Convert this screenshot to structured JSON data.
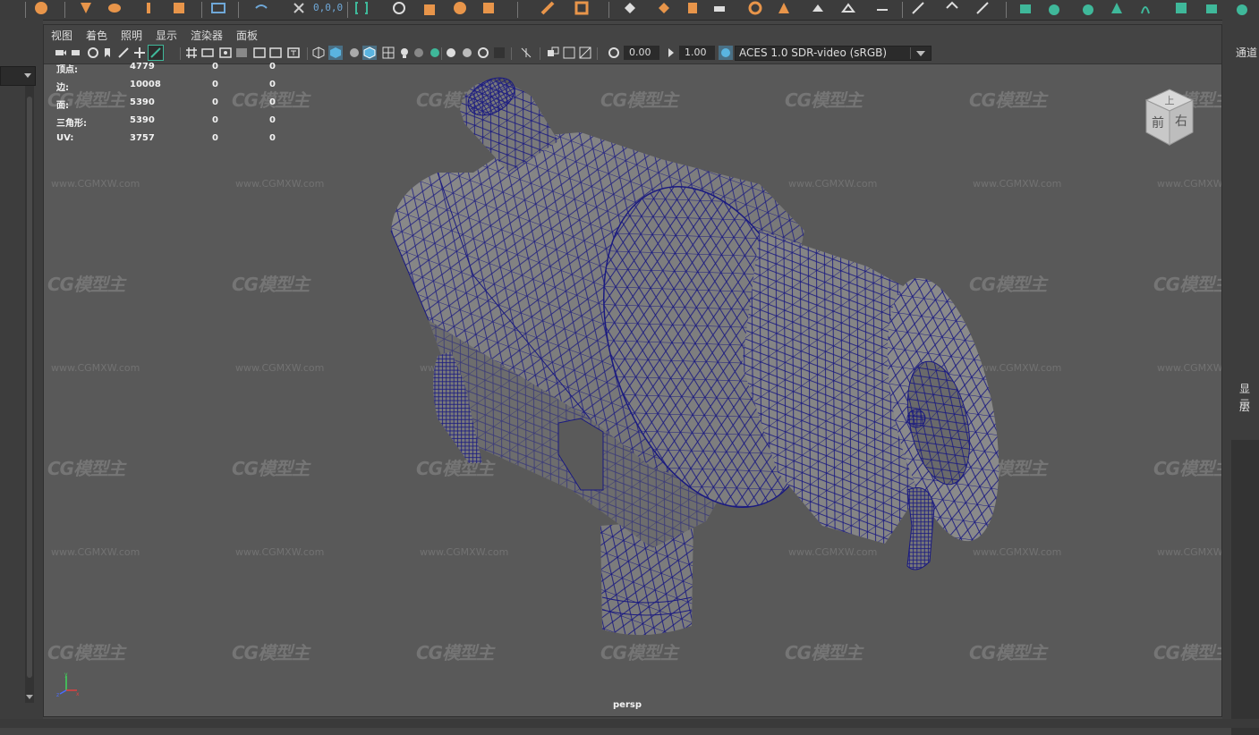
{
  "top_shelf": {
    "coord_text": "0,0,0"
  },
  "menu": [
    "视图",
    "着色",
    "照明",
    "显示",
    "渲染器",
    "面板"
  ],
  "toolbar": {
    "exposure": "0.00",
    "gamma": "1.00",
    "color_space": "ACES 1.0 SDR-video (sRGB)"
  },
  "hud": {
    "rows": [
      {
        "label": "顶点:",
        "v1": "4779",
        "v2": "0",
        "v3": "0"
      },
      {
        "label": "边:",
        "v1": "10008",
        "v2": "0",
        "v3": "0"
      },
      {
        "label": "面:",
        "v1": "5390",
        "v2": "0",
        "v3": "0"
      },
      {
        "label": "三角形:",
        "v1": "5390",
        "v2": "0",
        "v3": "0"
      },
      {
        "label": "UV:",
        "v1": "3757",
        "v2": "0",
        "v3": "0"
      }
    ]
  },
  "viewport": {
    "camera_label": "persp"
  },
  "viewcube": {
    "front_label": "前",
    "right_label": "右",
    "top_label": "上"
  },
  "watermark": {
    "logo_text": "CG模型主",
    "url_text": "www.CGMXW.com"
  },
  "right_panel": {
    "channels_label": "通道",
    "display_label": "显示",
    "layer_label": "层"
  },
  "colors": {
    "wire": "#1a1a80",
    "viewport_bg": "#595959",
    "accent_orange": "#e8954a",
    "accent_green": "#3fb89a"
  }
}
